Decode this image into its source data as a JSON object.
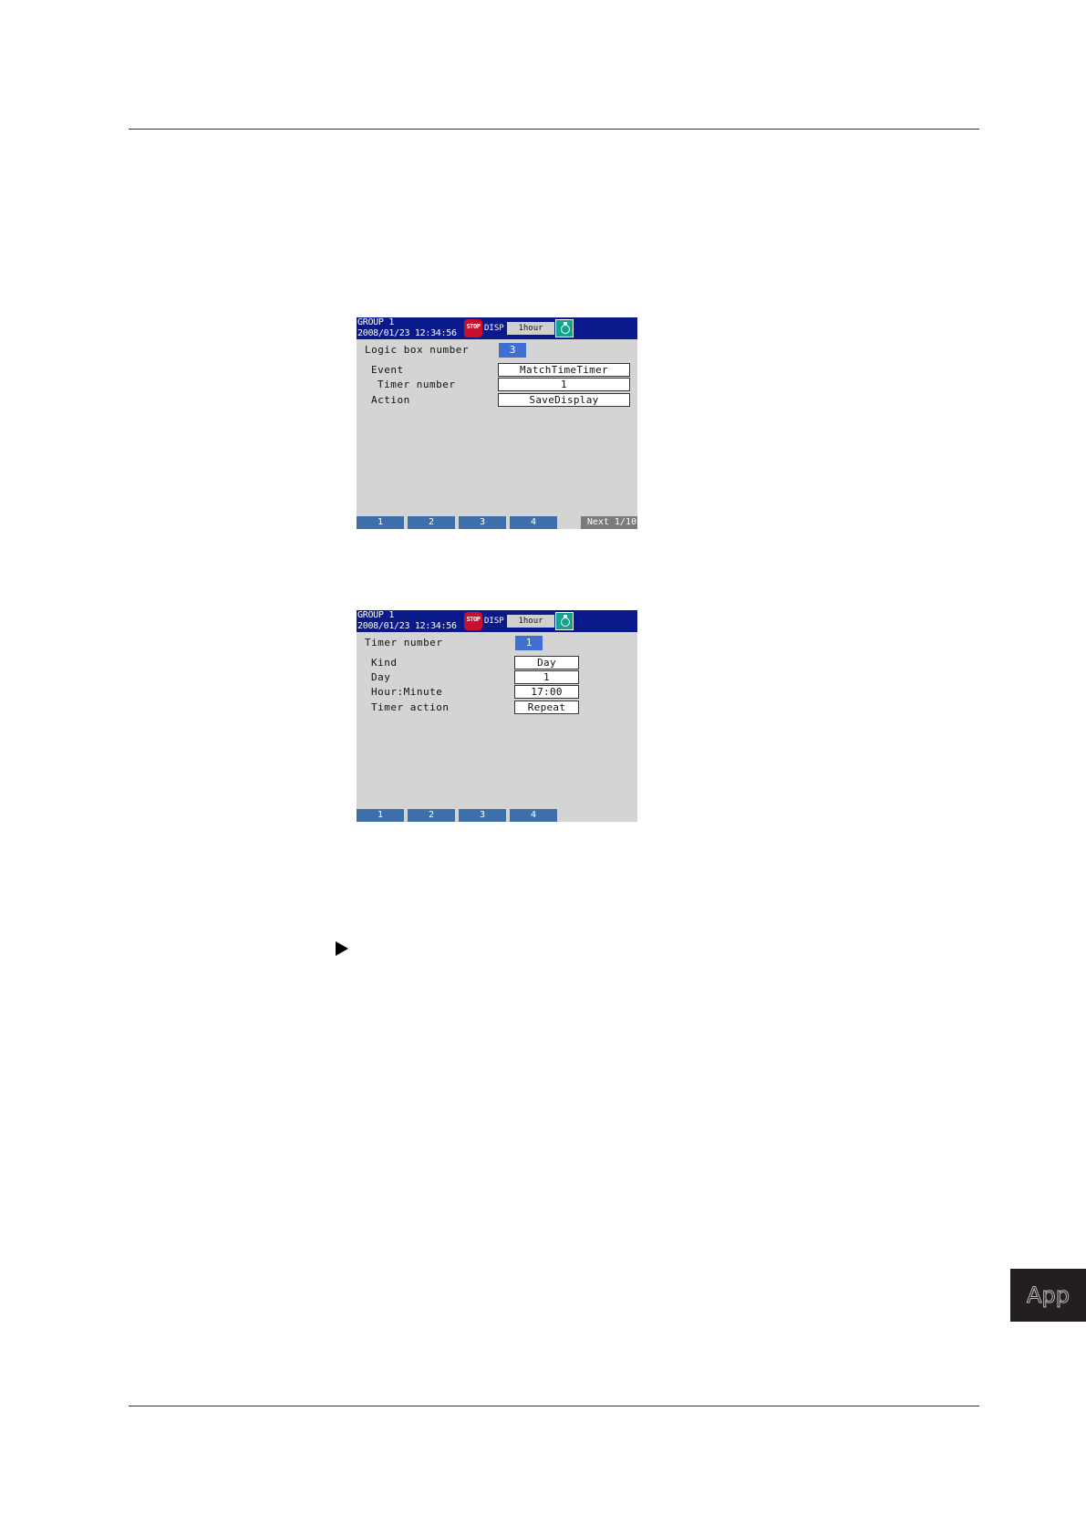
{
  "screen1": {
    "header": {
      "group": "GROUP 1",
      "datetime": "2008/01/23 12:34:56",
      "stop_label": "STOP",
      "mode": "DISP",
      "time_div": "1hour"
    },
    "logic_box_label": "Logic box number",
    "logic_box_value": "3",
    "event_label": "Event",
    "event_value": "MatchTimeTimer",
    "timer_number_label": "Timer number",
    "timer_number_value": "1",
    "action_label": "Action",
    "action_value": "SaveDisplay",
    "softkeys": [
      "1",
      "2",
      "3",
      "4"
    ],
    "next_label": "Next 1/10"
  },
  "screen2": {
    "header": {
      "group": "GROUP 1",
      "datetime": "2008/01/23 12:34:56",
      "stop_label": "STOP",
      "mode": "DISP",
      "time_div": "1hour"
    },
    "timer_number_label": "Timer number",
    "timer_number_value": "1",
    "kind_label": "Kind",
    "kind_value": "Day",
    "day_label": "Day",
    "day_value": "1",
    "hour_minute_label": "Hour:Minute",
    "hour_minute_value": "17:00",
    "timer_action_label": "Timer action",
    "timer_action_value": "Repeat",
    "softkeys": [
      "1",
      "2",
      "3",
      "4"
    ]
  },
  "app_tab": "App"
}
